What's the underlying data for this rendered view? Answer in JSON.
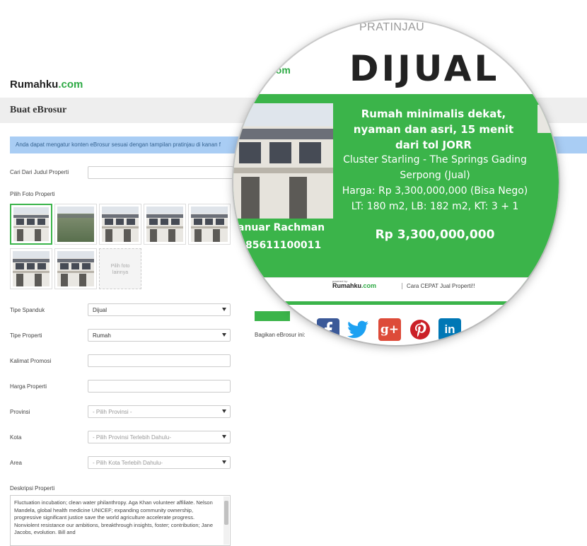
{
  "header": {
    "logo_brand": "Rumahku",
    "logo_domain": ".com",
    "page_title": "Buat eBrosur"
  },
  "info_text": "Anda dapat mengatur konten eBrosur sesuai dengan tampilan pratinjau di kanan f",
  "form": {
    "search_label": "Cari Dari Judul Properti",
    "search_value": "",
    "photo_label": "Pilih Foto Properti",
    "photo_placeholder": "Pilih foto lainnya",
    "banner_label": "Tipe Spanduk",
    "banner_value": "Dijual",
    "type_label": "Tipe Properti",
    "type_value": "Rumah",
    "promo_label": "Kalimat Promosi",
    "promo_value": "",
    "price_label": "Harga Properti",
    "price_value": "",
    "province_label": "Provinsi",
    "province_value": "- Pilih Provinsi -",
    "city_label": "Kota",
    "city_value": "- Pilih Provinsi Terlebih Dahulu-",
    "area_label": "Area",
    "area_value": "- Pilih Kota Terlebih Dahulu-",
    "desc_label": "Deskripsi Properti",
    "desc_value": "Fluctuation incubation; clean water philanthropy. Aga Khan volunteer affiliate. Nelson Mandela, global health medicine UNICEF; expanding community ownership, progressive significant justice save the world agriculture accelerate progress. Nonviolent resistance our ambitions, breakthrough insights, foster; contribution; Jane Jacobs, evolution. Bill and"
  },
  "share": {
    "label": "Bagikan eBrosur ini:",
    "icons": [
      "facebook-icon",
      "twitter-icon",
      "google-plus-icon",
      "pinterest-icon",
      "linkedin-icon"
    ]
  },
  "preview": {
    "heading": "PRATINJAU",
    "logo_fragment": "com",
    "banner": "DIJUAL",
    "headline": "Rumah minimalis dekat, nyaman dan asri, 15 menit dari tol JORR",
    "listing": "Cluster Starling - The Springs Gading Serpong (Jual)",
    "price_line": "Harga: Rp 3,300,000,000 (Bisa Nego)",
    "size_line": "LT: 180 m2, LB: 182 m2, KT: 3 + 1",
    "price": "Rp 3,300,000,000",
    "agent_name": "anuar Rachman",
    "agent_phone": "85611100011",
    "footer_powered": "powered by:",
    "footer_brand": "Rumahku",
    "footer_domain": ".com",
    "footer_tagline": "Cara CEPAT Jual Properti!!"
  },
  "colors": {
    "brand_green": "#3bb44a",
    "info_blue": "#a9cdf4",
    "facebook": "#3b5998",
    "twitter": "#1da1f2",
    "google_plus": "#dd4b39",
    "pinterest": "#cb2027",
    "linkedin": "#0077b5"
  }
}
